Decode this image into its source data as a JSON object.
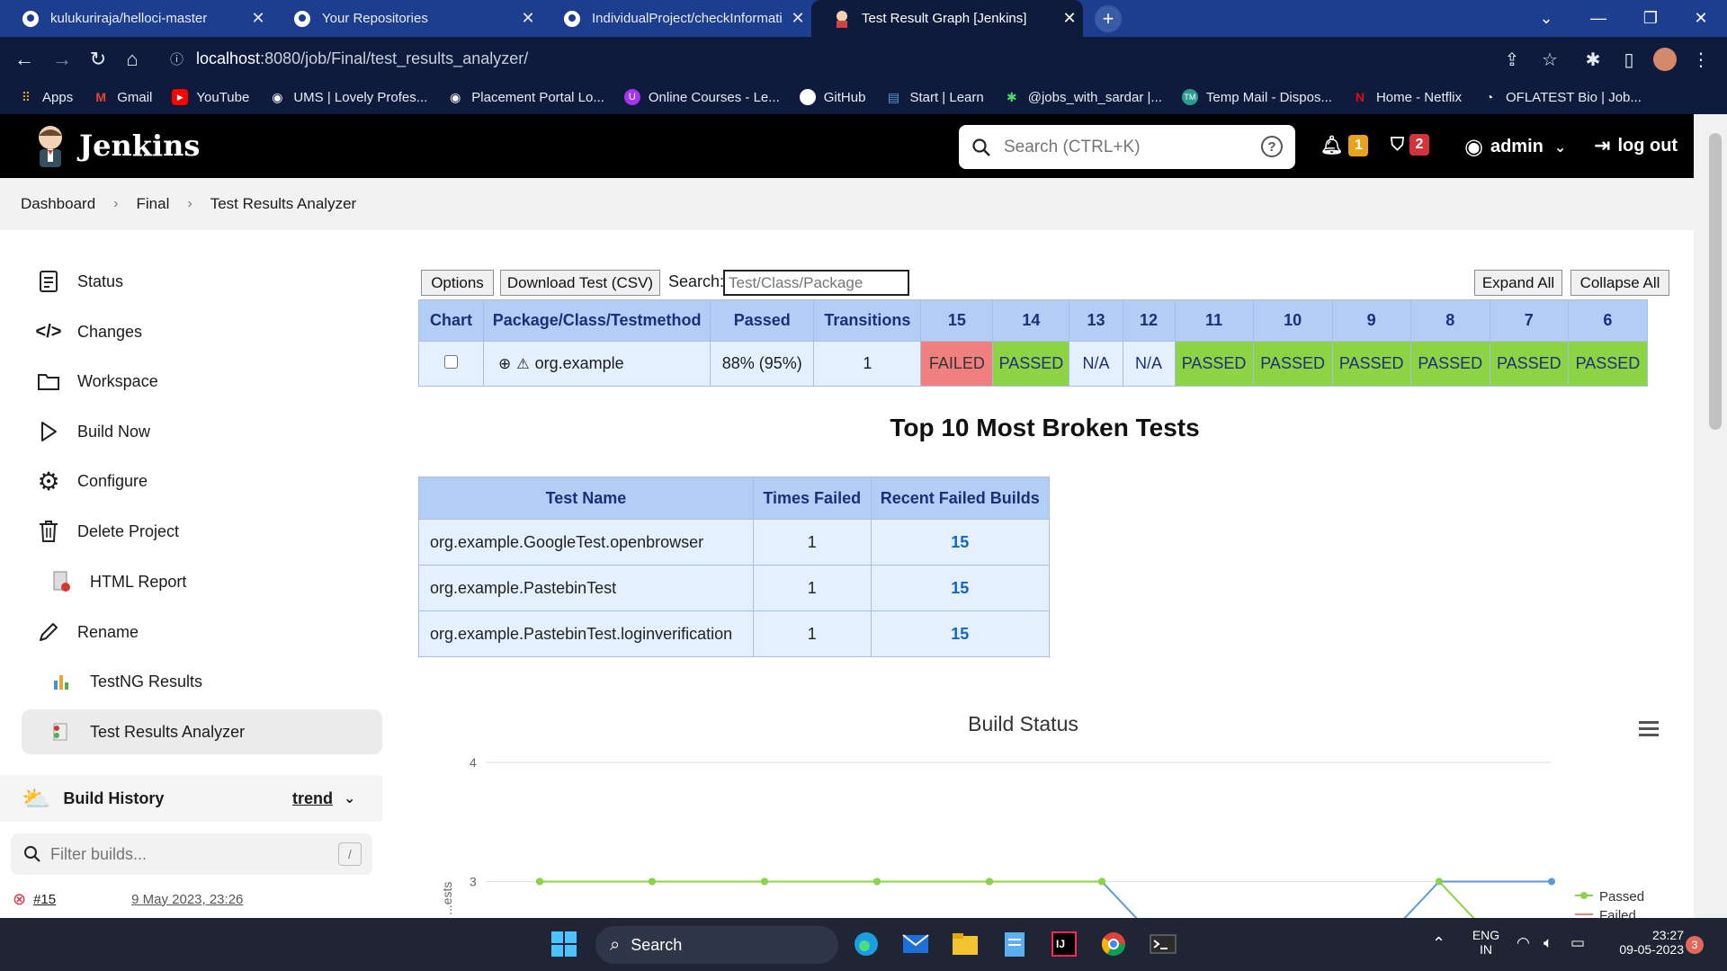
{
  "browser": {
    "tabs": [
      {
        "label": "kulukuriraja/helloci-master",
        "icon": "github-icon"
      },
      {
        "label": "Your Repositories",
        "icon": "github-icon"
      },
      {
        "label": "IndividualProject/checkInformati",
        "icon": "github-icon"
      },
      {
        "label": "Test Result Graph [Jenkins]",
        "icon": "jenkins-icon",
        "active": true
      }
    ],
    "url_host": "localhost",
    "url_rest": ":8080/job/Final/test_results_analyzer/",
    "bookmarks": [
      {
        "label": "Apps",
        "icon": "apps-grid-icon"
      },
      {
        "label": "Gmail",
        "icon": "gmail-icon"
      },
      {
        "label": "YouTube",
        "icon": "youtube-icon"
      },
      {
        "label": "UMS | Lovely Profes...",
        "icon": "globe-icon"
      },
      {
        "label": "Placement Portal Lo...",
        "icon": "globe-icon"
      },
      {
        "label": "Online Courses - Le...",
        "icon": "udemy-icon"
      },
      {
        "label": "GitHub",
        "icon": "github-icon"
      },
      {
        "label": "Start | Learn",
        "icon": "learn-icon"
      },
      {
        "label": "@jobs_with_sardar |...",
        "icon": "star-icon"
      },
      {
        "label": "Temp Mail - Dispos...",
        "icon": "mail-icon"
      },
      {
        "label": "Home - Netflix",
        "icon": "netflix-icon"
      },
      {
        "label": "OFLATEST Bio | Job...",
        "icon": "link-icon"
      }
    ]
  },
  "jenkins": {
    "title": "Jenkins",
    "search_placeholder": "Search (CTRL+K)",
    "notifications_count": "1",
    "security_count": "2",
    "user": "admin",
    "logout": "log out"
  },
  "breadcrumb": [
    "Dashboard",
    "Final",
    "Test Results Analyzer"
  ],
  "sidebar": {
    "items": [
      {
        "label": "Status",
        "icon": "status-icon"
      },
      {
        "label": "Changes",
        "icon": "code-icon"
      },
      {
        "label": "Workspace",
        "icon": "folder-icon"
      },
      {
        "label": "Build Now",
        "icon": "play-icon"
      },
      {
        "label": "Configure",
        "icon": "gear-icon"
      },
      {
        "label": "Delete Project",
        "icon": "trash-icon"
      },
      {
        "label": "HTML Report",
        "icon": "report-icon"
      },
      {
        "label": "Rename",
        "icon": "pencil-icon"
      },
      {
        "label": "TestNG Results",
        "icon": "chart-icon"
      },
      {
        "label": "Test Results Analyzer",
        "icon": "analyzer-icon",
        "selected": true
      }
    ],
    "build_history": {
      "title": "Build History",
      "trend": "trend",
      "filter_placeholder": "Filter builds...",
      "filter_shortcut": "/",
      "builds": [
        {
          "number": "#15",
          "date": "9 May 2023, 23:26",
          "status": "failed"
        }
      ]
    }
  },
  "toolbar": {
    "options": "Options",
    "download": "Download Test (CSV)",
    "search_label": "Search:",
    "search_placeholder": "Test/Class/Package",
    "expand_all": "Expand All",
    "collapse_all": "Collapse All"
  },
  "results_table": {
    "headers": [
      "Chart",
      "Package/Class/Testmethod",
      "Passed",
      "Transitions",
      "15",
      "14",
      "13",
      "12",
      "11",
      "10",
      "9",
      "8",
      "7",
      "6"
    ],
    "row": {
      "package": "org.example",
      "passed": "88% (95%)",
      "transitions": "1",
      "statuses": [
        "FAILED",
        "PASSED",
        "N/A",
        "N/A",
        "PASSED",
        "PASSED",
        "PASSED",
        "PASSED",
        "PASSED",
        "PASSED"
      ]
    }
  },
  "broken": {
    "title": "Top 10 Most Broken Tests",
    "headers": [
      "Test Name",
      "Times Failed",
      "Recent Failed Builds"
    ],
    "rows": [
      {
        "name": "org.example.GoogleTest.openbrowser",
        "times": "1",
        "builds": "15"
      },
      {
        "name": "org.example.PastebinTest",
        "times": "1",
        "builds": "15"
      },
      {
        "name": "org.example.PastebinTest.loginverification",
        "times": "1",
        "builds": "15"
      }
    ]
  },
  "chart_data": {
    "type": "line",
    "title": "Build Status",
    "ylabel": "...ests",
    "yticks": [
      3,
      4
    ],
    "ylim": [
      2,
      4
    ],
    "legend": [
      "Passed",
      "Failed"
    ],
    "legend_position": "bottom-right",
    "series": [
      {
        "name": "Passed",
        "color": "#8cd443",
        "values": [
          3,
          3,
          3,
          3,
          3,
          3,
          null,
          null,
          3,
          2
        ]
      },
      {
        "name": "Failed",
        "color": "#5b9bd5",
        "values": [
          3,
          3,
          3,
          3,
          3,
          3,
          2,
          2,
          3,
          3
        ]
      }
    ]
  },
  "taskbar": {
    "search": "Search",
    "lang_top": "ENG",
    "lang_bottom": "IN",
    "time": "23:27",
    "date": "09-05-2023",
    "notif_count": "3"
  }
}
